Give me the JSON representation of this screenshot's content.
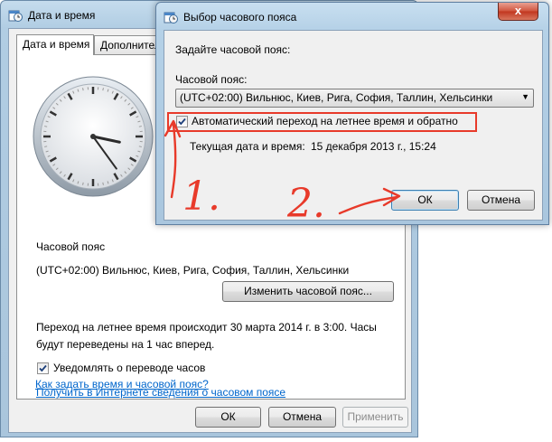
{
  "back_window": {
    "title": "Дата и время",
    "tabs": [
      "Дата и время",
      "Дополнительные часы"
    ],
    "timezone_heading": "Часовой пояс",
    "timezone_value": "(UTC+02:00) Вильнюс, Киев, Рига, София, Таллин, Хельсинки",
    "change_tz_button": "Изменить часовой пояс...",
    "dst_info": "Переход на летнее время происходит 30 марта 2014 г. в 3:00. Часы будут переведены на 1 час вперед.",
    "notify_checkbox": "Уведомлять о переводе часов",
    "notify_checked": true,
    "link_online": "Получить в Интернете сведения о часовом поясе",
    "link_how": "Как задать время и часовой пояс?",
    "ok_button": "ОК",
    "cancel_button": "Отмена",
    "apply_button": "Применить"
  },
  "front_window": {
    "title": "Выбор часового пояса",
    "prompt": "Задайте часовой пояс:",
    "tz_label": "Часовой пояс:",
    "tz_selected": "(UTC+02:00) Вильнюс, Киев, Рига, София, Таллин, Хельсинки",
    "auto_dst_checkbox": "Автоматический переход на летнее время и обратно",
    "auto_dst_checked": true,
    "current_datetime_label": "Текущая дата и время:",
    "current_datetime_value": "15 декабря 2013 г., 15:24",
    "ok_button": "ОК",
    "cancel_button": "Отмена",
    "close_glyph": "x"
  },
  "annotations": {
    "step1": "1.",
    "step2": "2.",
    "color": "#e83a2a"
  },
  "clock": {
    "hour": 3,
    "minute": 24
  },
  "icons": {
    "title_icon": "datetime-icon",
    "close": "close-icon",
    "checkmark": "checkmark-icon",
    "dropdown": "chevron-down-icon"
  }
}
